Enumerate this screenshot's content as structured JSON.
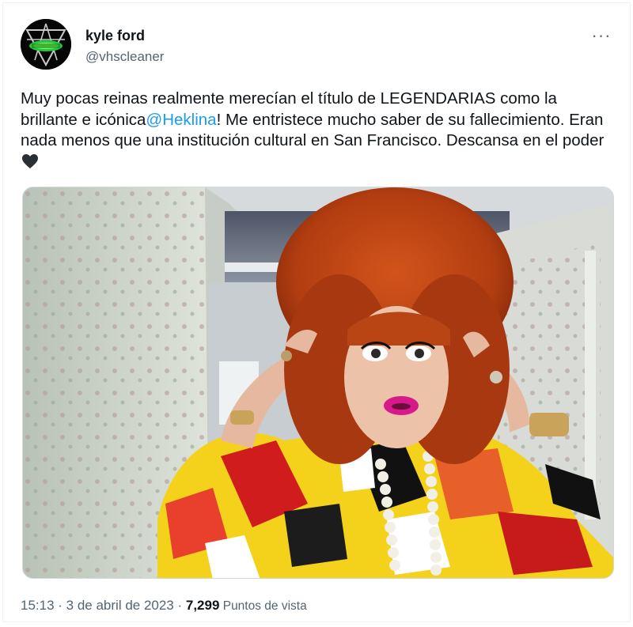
{
  "author": {
    "display_name": "kyle ford",
    "handle": "@vhscleaner",
    "avatar_icon": "pentagram-avatar-icon"
  },
  "menu": {
    "more_icon": "more-horizontal-icon",
    "glyph": "···"
  },
  "tweet": {
    "text_part1": "Muy pocas reinas realmente merecían el título de LEGENDARIAS como la brillante e icónica",
    "mention": "@Heklina",
    "text_part2": "! Me entristece mucho saber de su fallecimiento. Eran nada menos que una institución cultural en San Francisco. Descansa en el poder",
    "emoji_icon": "black-heart-icon"
  },
  "media": {
    "type": "photo",
    "icon": "photo-drag-queen-red-beehive-wig"
  },
  "meta": {
    "time": "15:13",
    "separator1": " · ",
    "date": "3 de abril de 2023",
    "separator2": " · ",
    "views_count": "7,299",
    "views_label": " Puntos de vista"
  },
  "colors": {
    "link": "#1d9bf0",
    "text": "#0f1419",
    "secondary": "#536471",
    "border": "#cfd9de"
  }
}
